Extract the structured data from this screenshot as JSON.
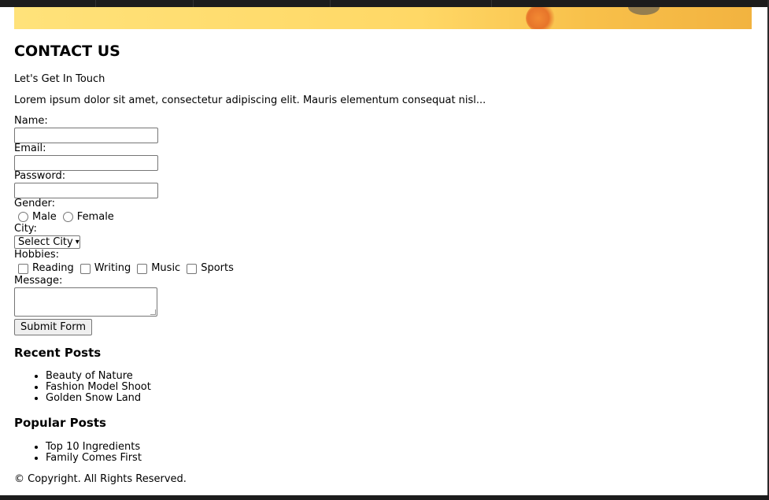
{
  "page": {
    "title": "CONTACT US",
    "subtitle": "Let's Get In Touch",
    "intro": "Lorem ipsum dolor sit amet, consectetur adipiscing elit. Mauris elementum consequat nisl..."
  },
  "form": {
    "name_label": "Name:",
    "name_value": "",
    "email_label": "Email:",
    "email_value": "",
    "password_label": "Password:",
    "password_value": "",
    "gender_label": "Gender:",
    "gender_options": [
      "Male",
      "Female"
    ],
    "city_label": "City:",
    "city_selected": "Select City",
    "hobbies_label": "Hobbies:",
    "hobbies_options": [
      "Reading",
      "Writing",
      "Music",
      "Sports"
    ],
    "message_label": "Message:",
    "message_value": "",
    "submit_label": "Submit Form"
  },
  "recent_posts": {
    "heading": "Recent Posts",
    "items": [
      "Beauty of Nature",
      "Fashion Model Shoot",
      "Golden Snow Land"
    ]
  },
  "popular_posts": {
    "heading": "Popular Posts",
    "items": [
      "Top 10 Ingredients",
      "Family Comes First"
    ]
  },
  "footer": {
    "copyright": "© Copyright. All Rights Reserved."
  },
  "colors": {
    "banner_start": "#ffe27a",
    "banner_end": "#f2b340",
    "frame": "#1c1c1c"
  }
}
